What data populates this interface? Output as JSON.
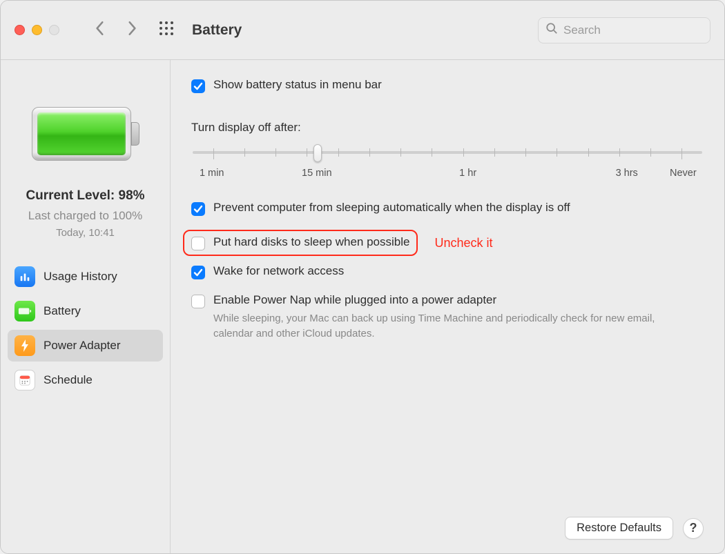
{
  "window": {
    "title": "Battery"
  },
  "search": {
    "placeholder": "Search"
  },
  "sidebar": {
    "current_level_label": "Current Level: 98%",
    "last_charged_label": "Last charged to 100%",
    "last_charged_time": "Today, 10:41",
    "items": [
      {
        "label": "Usage History",
        "icon": "chart-icon",
        "color": "blue"
      },
      {
        "label": "Battery",
        "icon": "battery-icon",
        "color": "green"
      },
      {
        "label": "Power Adapter",
        "icon": "bolt-icon",
        "color": "amber",
        "selected": true
      },
      {
        "label": "Schedule",
        "icon": "calendar-icon",
        "color": "white"
      }
    ]
  },
  "main": {
    "show_status_label": "Show battery status in menu bar",
    "show_status_checked": true,
    "slider": {
      "title": "Turn display off after:",
      "labels": [
        "1 min",
        "15 min",
        "1 hr",
        "3 hrs",
        "Never"
      ],
      "value_label": "15 min"
    },
    "options": [
      {
        "label": "Prevent computer from sleeping automatically when the display is off",
        "checked": true
      },
      {
        "label": "Put hard disks to sleep when possible",
        "checked": false,
        "highlighted": true,
        "annotation": "Uncheck it"
      },
      {
        "label": "Wake for network access",
        "checked": true
      },
      {
        "label": "Enable Power Nap while plugged into a power adapter",
        "checked": false,
        "description": "While sleeping, your Mac can back up using Time Machine and periodically check for new email, calendar and other iCloud updates."
      }
    ],
    "restore_label": "Restore Defaults",
    "help_label": "?"
  }
}
